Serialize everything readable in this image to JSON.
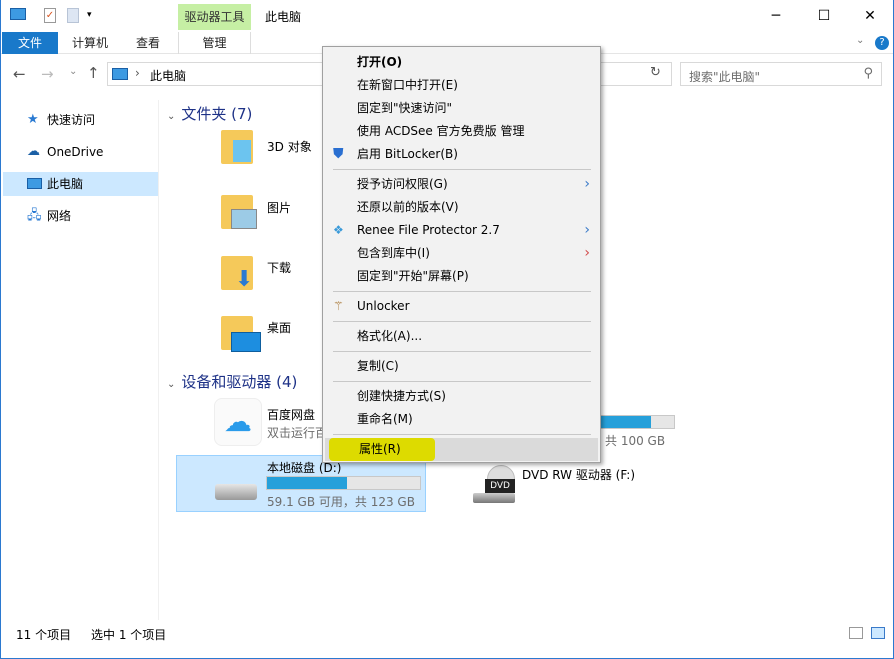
{
  "window": {
    "title": "此电脑",
    "context_tab": "驱动器工具",
    "controls": {
      "minimize": "─",
      "maximize": "☐",
      "close": "✕"
    }
  },
  "ribbon": {
    "tabs": [
      "文件",
      "计算机",
      "查看",
      "管理"
    ]
  },
  "address": {
    "path": "此电脑",
    "search_placeholder": "搜索\"此电脑\""
  },
  "nav": {
    "items": [
      {
        "label": "快速访问",
        "icon": "star-icon"
      },
      {
        "label": "OneDrive",
        "icon": "cloud-icon"
      },
      {
        "label": "此电脑",
        "icon": "computer-icon",
        "selected": true
      },
      {
        "label": "网络",
        "icon": "network-icon"
      }
    ]
  },
  "folders": {
    "header": "文件夹 (7)",
    "items": [
      "3D 对象",
      "图片",
      "下载",
      "桌面"
    ]
  },
  "devices": {
    "header": "设备和驱动器 (4)",
    "baidu": {
      "name": "百度网盘",
      "desc": "双击运行百"
    },
    "local_disk": {
      "name": "本地磁盘 (D:)",
      "info": "59.1 GB 可用，共 123 GB",
      "used_percent": 52
    },
    "hidden_drive": {
      "info": "共 100 GB",
      "used_percent": 85
    },
    "dvd": {
      "name": "DVD RW 驱动器 (F:)",
      "badge": "DVD"
    }
  },
  "context_menu": {
    "items": [
      "打开(O)",
      "在新窗口中打开(E)",
      "固定到\"快速访问\"",
      "使用 ACDSee 官方免费版 管理",
      "启用 BitLocker(B)",
      "授予访问权限(G)",
      "还原以前的版本(V)",
      "Renee File Protector 2.7",
      "包含到库中(I)",
      "固定到\"开始\"屏幕(P)",
      "Unlocker",
      "格式化(A)...",
      "复制(C)",
      "创建快捷方式(S)",
      "重命名(M)",
      "属性(R)"
    ],
    "highlighted": "属性(R)",
    "highlight_color": "#dddb00"
  },
  "status": {
    "count": "11 个项目",
    "selected": "选中 1 个项目"
  }
}
